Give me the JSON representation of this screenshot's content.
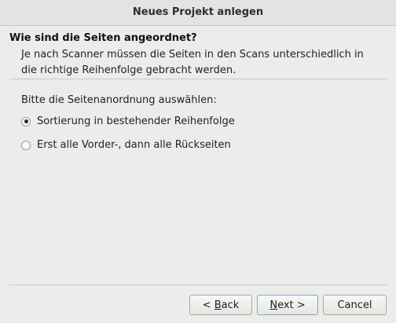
{
  "window": {
    "title": "Neues Projekt anlegen"
  },
  "header": {
    "heading": "Wie sind die Seiten angeordnet?",
    "description_line1": "Je nach Scanner müssen die Seiten in den Scans unterschiedlich in",
    "description_line2": "die richtige Reihenfolge gebracht werden."
  },
  "content": {
    "prompt": "Bitte die Seitenanordnung auswählen:",
    "options": [
      {
        "label": "Sortierung in bestehender Reihenfolge",
        "selected": true
      },
      {
        "label": "Erst alle Vorder-, dann alle Rückseiten",
        "selected": false
      }
    ]
  },
  "buttons": {
    "back": {
      "prefix": "< ",
      "mnemonic": "B",
      "rest": "ack"
    },
    "next": {
      "mnemonic": "N",
      "rest": "ext >"
    },
    "cancel": {
      "label": "Cancel"
    }
  }
}
